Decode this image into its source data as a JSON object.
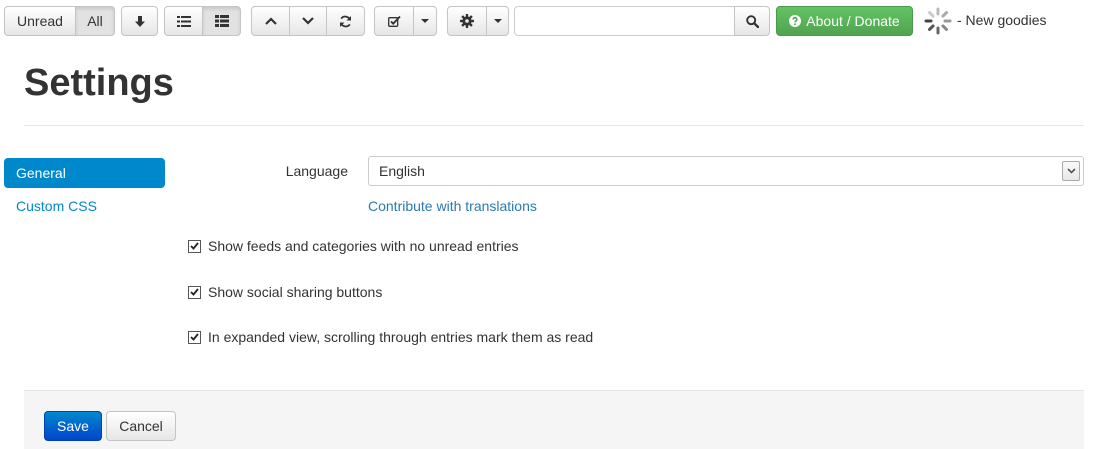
{
  "toolbar": {
    "unread_label": "Unread",
    "all_label": "All",
    "about_label": "About / Donate",
    "search_placeholder": "",
    "search_value": "",
    "new_goodies": "- New goodies",
    "accent_green": "#5bb75b"
  },
  "page": {
    "title": "Settings"
  },
  "sidebar": {
    "items": [
      {
        "label": "General",
        "active": true
      },
      {
        "label": "Custom CSS",
        "active": false
      }
    ]
  },
  "form": {
    "language_label": "Language",
    "language_value": "English",
    "contribute_link": "Contribute with translations",
    "checkboxes": [
      {
        "label": "Show feeds and categories with no unread entries",
        "checked": true
      },
      {
        "label": "Show social sharing buttons",
        "checked": true
      },
      {
        "label": "In expanded view, scrolling through entries mark them as read",
        "checked": true
      }
    ]
  },
  "actions": {
    "save_label": "Save",
    "cancel_label": "Cancel"
  },
  "colors": {
    "primary": "#0088cc",
    "link": "#2a7ab0"
  }
}
